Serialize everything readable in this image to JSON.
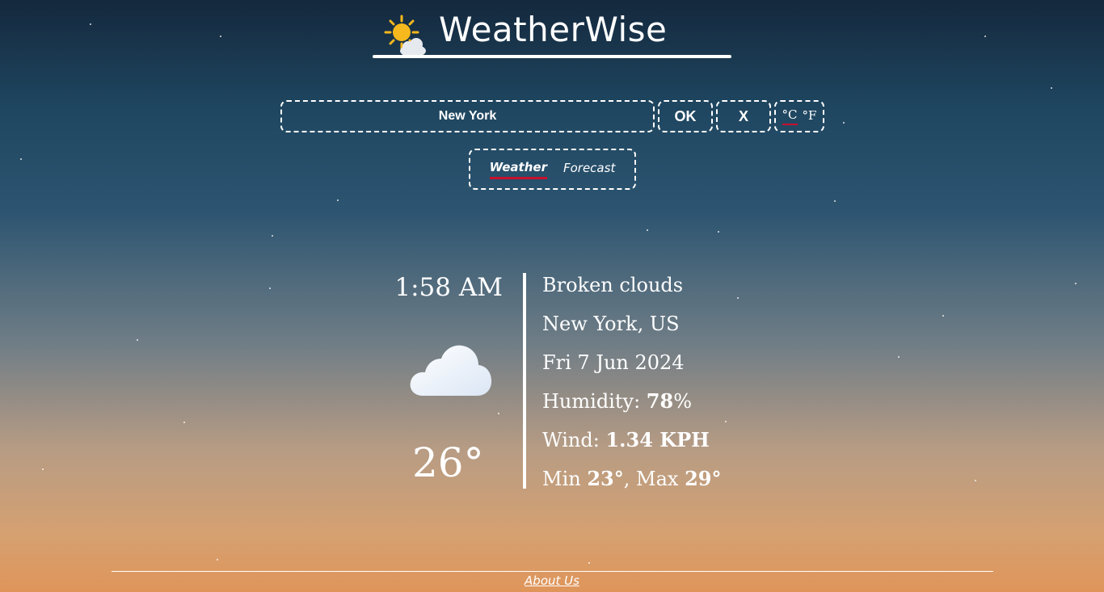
{
  "app": {
    "title": "WeatherWise"
  },
  "search": {
    "value": "New York",
    "ok_label": "OK",
    "clear_label": "X"
  },
  "units": {
    "celsius": "°C",
    "fahrenheit": "°F",
    "selected": "celsius"
  },
  "tabs": [
    {
      "label": "Weather",
      "active": true
    },
    {
      "label": "Forecast",
      "active": false
    }
  ],
  "current": {
    "time": "1:58 AM",
    "temperature": "26°",
    "icon": "cloud-icon",
    "description": "Broken clouds",
    "location": "New York, US",
    "date": "Fri 7 Jun 2024",
    "humidity_label": "Humidity: ",
    "humidity_value": "78",
    "humidity_unit": "%",
    "wind_label": "Wind: ",
    "wind_value": "1.34 KPH",
    "min_label": "Min ",
    "min_value": "23°",
    "max_label": ", Max ",
    "max_value": "29°"
  },
  "footer": {
    "about_label": "About Us"
  },
  "colors": {
    "accent_underline": "#c8102e",
    "sun": "#f6b81c"
  }
}
